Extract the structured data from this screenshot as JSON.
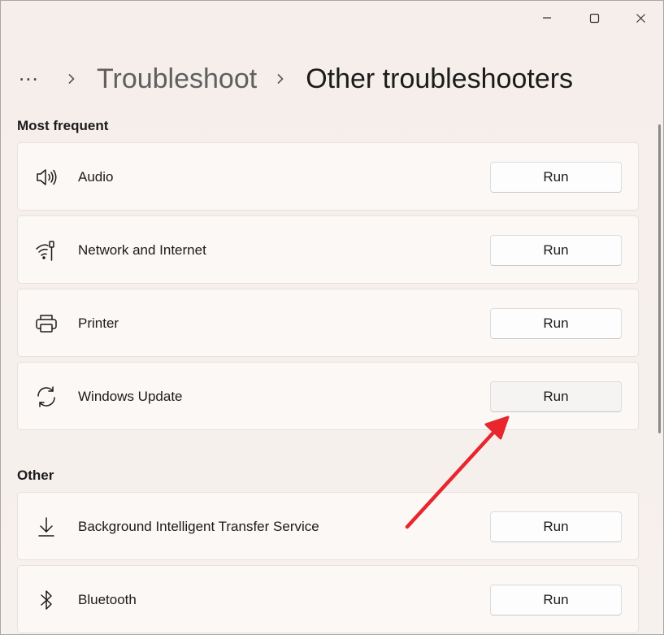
{
  "window": {
    "controls": {
      "minimize": "minimize-icon",
      "maximize": "maximize-icon",
      "close": "close-icon"
    }
  },
  "breadcrumb": {
    "overflow": "...",
    "parent": "Troubleshoot",
    "current": "Other troubleshooters"
  },
  "sections": {
    "most_frequent": {
      "title": "Most frequent",
      "items": [
        {
          "icon": "speaker-icon",
          "label": "Audio",
          "button": "Run"
        },
        {
          "icon": "wifi-network-icon",
          "label": "Network and Internet",
          "button": "Run"
        },
        {
          "icon": "printer-icon",
          "label": "Printer",
          "button": "Run"
        },
        {
          "icon": "sync-update-icon",
          "label": "Windows Update",
          "button": "Run"
        }
      ]
    },
    "other": {
      "title": "Other",
      "items": [
        {
          "icon": "download-icon",
          "label": "Background Intelligent Transfer Service",
          "button": "Run"
        },
        {
          "icon": "bluetooth-icon",
          "label": "Bluetooth",
          "button": "Run"
        }
      ]
    }
  },
  "annotation": {
    "arrow_color": "#e8262d"
  },
  "colors": {
    "background": "#f6efea",
    "card": "#fbf8f6",
    "text": "#1b1b1b"
  }
}
